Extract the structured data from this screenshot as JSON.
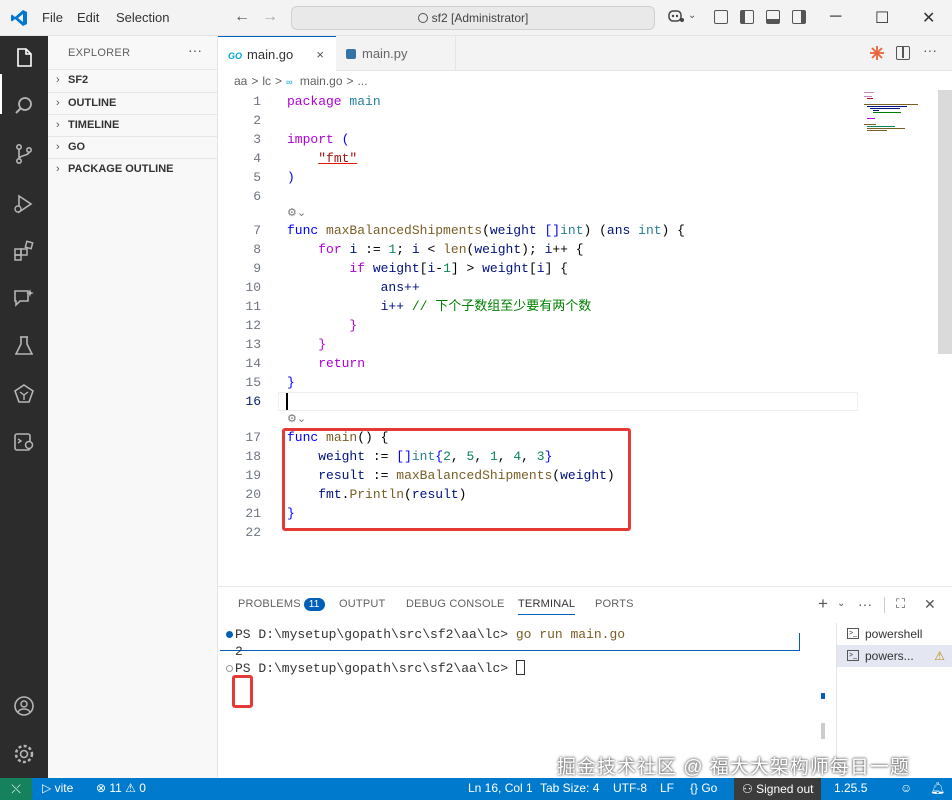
{
  "menu": {
    "file": "File",
    "edit": "Edit",
    "selection": "Selection"
  },
  "command_center": "sf2 [Administrator]",
  "sidebar": {
    "title": "EXPLORER",
    "more": "···",
    "sections": [
      "SF2",
      "OUTLINE",
      "TIMELINE",
      "GO",
      "PACKAGE OUTLINE"
    ]
  },
  "tabs": [
    {
      "badge": "GO",
      "label": "main.go",
      "close": "×"
    },
    {
      "label": "main.py"
    }
  ],
  "breadcrumb": [
    "aa",
    ">",
    "lc",
    ">",
    "main.go",
    ">",
    "..."
  ],
  "editor": {
    "line_numbers": [
      "1",
      "2",
      "3",
      "4",
      "5",
      "6",
      "7",
      "8",
      "9",
      "10",
      "11",
      "12",
      "13",
      "14",
      "15",
      "16",
      "17",
      "18",
      "19",
      "20",
      "21",
      "22"
    ],
    "code": {
      "l1a": "package",
      "l1b": "main",
      "l3a": "import",
      "l3b": "(",
      "l4": "\"fmt\"",
      "l5": ")",
      "l7a": "func",
      "l7b": "maxBalancedShipments",
      "l7c": "(",
      "l7d": "weight",
      "l7e": "[]",
      "l7f": "int",
      "l7g": ") (",
      "l7h": "ans",
      "l7i": "int",
      "l7j": ") {",
      "l8a": "for",
      "l8b": "i",
      "l8c": ":=",
      "l8d": "1",
      "l8e": "; ",
      "l8f": "i",
      "l8g": " < ",
      "l8h": "len",
      "l8i": "(",
      "l8j": "weight",
      "l8k": "); ",
      "l8l": "i",
      "l8m": "++ {",
      "l9a": "if",
      "l9b": "weight",
      "l9c": "[",
      "l9d": "i",
      "l9e": "-",
      "l9f": "1",
      "l9g": "] > ",
      "l9h": "weight",
      "l9i": "[",
      "l9j": "i",
      "l9k": "] {",
      "l10": "ans++",
      "l11a": "i++",
      "l11b": "// 下个子数组至少要有两个数",
      "l12": "}",
      "l13": "}",
      "l14": "return",
      "l15": "}",
      "l17a": "func",
      "l17b": "main",
      "l17c": "() {",
      "l18a": "weight",
      "l18b": ":=",
      "l18c": "[]",
      "l18d": "int",
      "l18e": "{",
      "l18f": "2",
      "l18g": ", ",
      "l18h": "5",
      "l18i": ", ",
      "l18j": "1",
      "l18k": ", ",
      "l18l": "4",
      "l18m": ", ",
      "l18n": "3",
      "l18o": "}",
      "l19a": "result",
      "l19b": ":=",
      "l19c": "maxBalancedShipments",
      "l19d": "(",
      "l19e": "weight",
      "l19f": ")",
      "l20a": "fmt",
      "l20b": ".",
      "l20c": "Println",
      "l20d": "(",
      "l20e": "result",
      "l20f": ")",
      "l21": "}"
    }
  },
  "panel": {
    "tabs": [
      "PROBLEMS",
      "OUTPUT",
      "DEBUG CONSOLE",
      "TERMINAL",
      "PORTS"
    ],
    "problems_count": "11",
    "terminal": {
      "prompt1": "PS D:\\mysetup\\gopath\\src\\sf2\\aa\\lc> ",
      "cmd1": "go run main.go",
      "output": "2",
      "prompt2": "PS D:\\mysetup\\gopath\\src\\sf2\\aa\\lc> "
    },
    "terminal_list": [
      "powershell",
      "powers..."
    ]
  },
  "statusbar": {
    "vite": "vite",
    "errors": "⊗ 11 ⚠ 0",
    "position": "Ln 16, Col 1",
    "tab_size": "Tab Size: 4",
    "encoding": "UTF-8",
    "eol": "LF",
    "language": "{} Go",
    "signed_out": "Signed out",
    "go_version": "1.25.5"
  },
  "watermark": "掘金技术社区 @ 福大大架构师每日一题",
  "colors": {
    "accent": "#007acc",
    "activity_bar": "#2c2c2c",
    "highlight_box": "#e53935"
  }
}
